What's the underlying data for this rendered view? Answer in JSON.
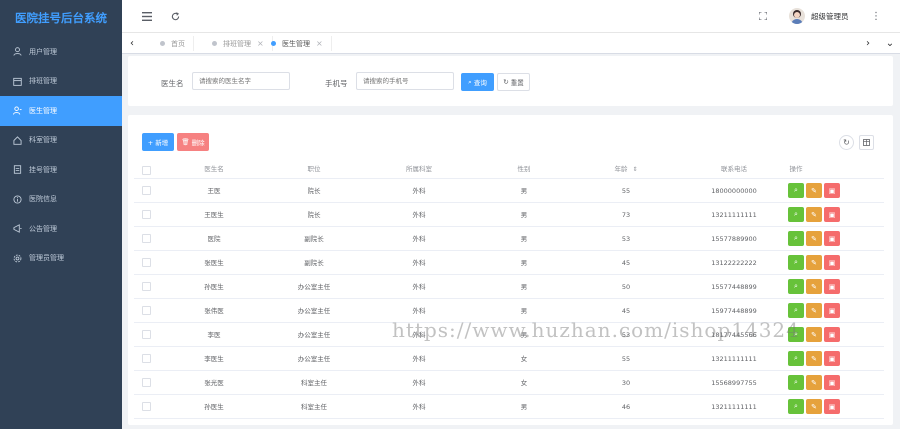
{
  "app": {
    "title": "医院挂号后台系统"
  },
  "sidebar": {
    "items": [
      {
        "label": "用户管理",
        "icon": "user-icon",
        "active": false
      },
      {
        "label": "排班管理",
        "icon": "calendar-icon",
        "active": false
      },
      {
        "label": "医生管理",
        "icon": "doctor-icon",
        "active": true
      },
      {
        "label": "科室管理",
        "icon": "home-icon",
        "active": false
      },
      {
        "label": "挂号管理",
        "icon": "register-icon",
        "active": false
      },
      {
        "label": "医院信息",
        "icon": "info-icon",
        "active": false
      },
      {
        "label": "公告管理",
        "icon": "notice-icon",
        "active": false
      },
      {
        "label": "管理员管理",
        "icon": "settings-icon",
        "active": false
      }
    ]
  },
  "navbar": {
    "username": "超级管理员"
  },
  "tags": [
    {
      "label": "首页",
      "active": false,
      "closable": false
    },
    {
      "label": "排班管理",
      "active": false,
      "closable": true
    },
    {
      "label": "医生管理",
      "active": true,
      "closable": true
    }
  ],
  "search": {
    "name_label": "医生名",
    "name_placeholder": "请搜索的医生名字",
    "phone_label": "手机号",
    "phone_placeholder": "请搜索的手机号",
    "search_btn": "查询",
    "reset_btn": "重置"
  },
  "toolbar": {
    "add_btn": "+ 新增",
    "delete_btn": "删除"
  },
  "table": {
    "columns": [
      "医生名",
      "职位",
      "所属科室",
      "性别",
      "年龄",
      "联系电话",
      "操作"
    ],
    "rows": [
      {
        "name": "王医",
        "title": "院长",
        "dept": "外科",
        "gender": "男",
        "age": "55",
        "phone": "18000000000"
      },
      {
        "name": "王医生",
        "title": "院长",
        "dept": "外科",
        "gender": "男",
        "age": "73",
        "phone": "13211111111"
      },
      {
        "name": "医院",
        "title": "副院长",
        "dept": "外科",
        "gender": "男",
        "age": "53",
        "phone": "15577889900"
      },
      {
        "name": "张医生",
        "title": "副院长",
        "dept": "外科",
        "gender": "男",
        "age": "45",
        "phone": "13122222222"
      },
      {
        "name": "孙医生",
        "title": "办公室主任",
        "dept": "外科",
        "gender": "男",
        "age": "50",
        "phone": "15577448899"
      },
      {
        "name": "张伟医",
        "title": "办公室主任",
        "dept": "外科",
        "gender": "男",
        "age": "45",
        "phone": "15977448899"
      },
      {
        "name": "李医",
        "title": "办公室主任",
        "dept": "外科",
        "gender": "男",
        "age": "53",
        "phone": "18177445566"
      },
      {
        "name": "李医生",
        "title": "办公室主任",
        "dept": "外科",
        "gender": "女",
        "age": "55",
        "phone": "13211111111"
      },
      {
        "name": "张光医",
        "title": "科室主任",
        "dept": "外科",
        "gender": "女",
        "age": "30",
        "phone": "15568997755"
      },
      {
        "name": "孙医生",
        "title": "科室主任",
        "dept": "外科",
        "gender": "男",
        "age": "46",
        "phone": "13211111111"
      }
    ]
  },
  "watermark": "https://www.huzhan.com/ishop14324"
}
